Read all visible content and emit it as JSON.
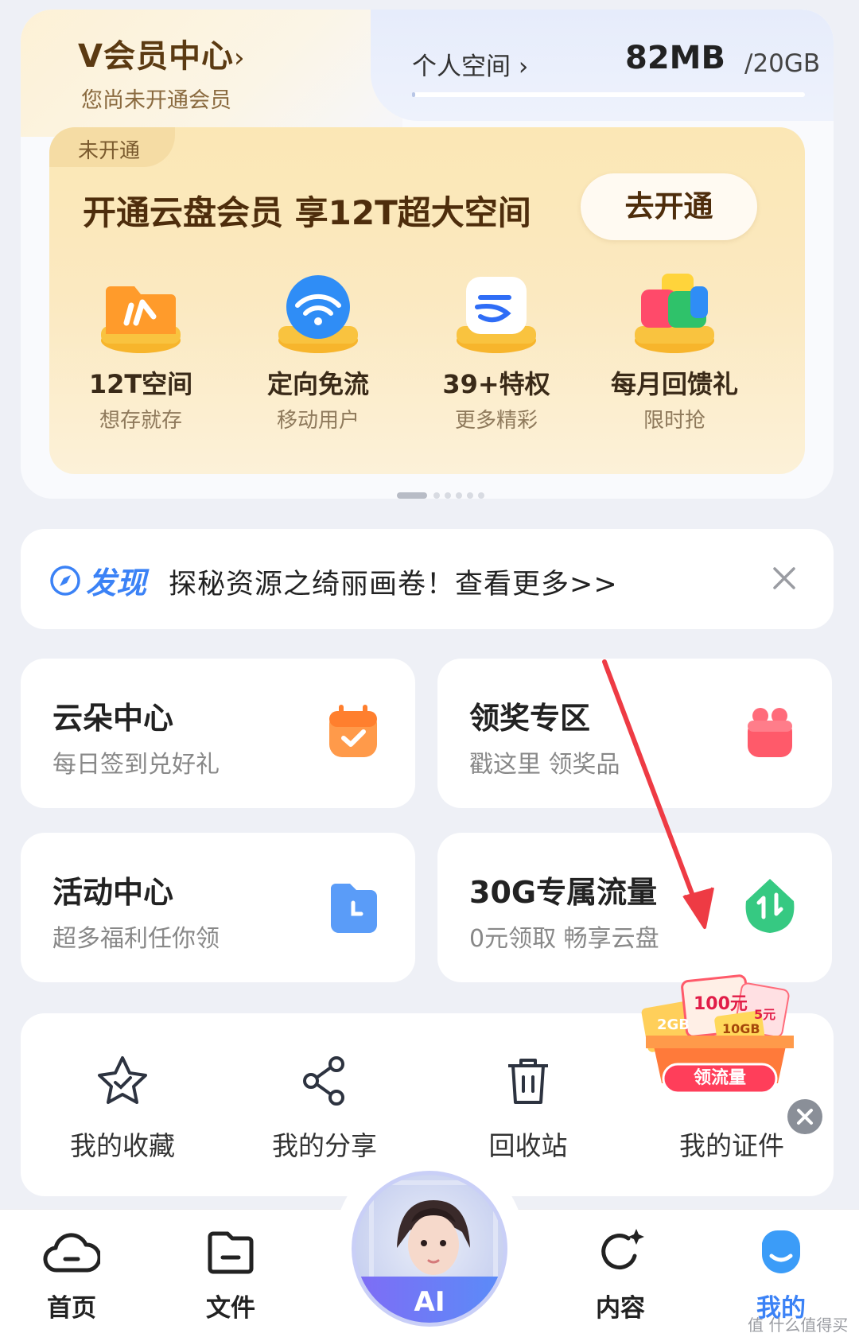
{
  "vip": {
    "title": "V会员中心",
    "chevron": "›",
    "subtitle": "您尚未开通会员",
    "personal_space_label": "个人空间 ›",
    "storage_used": "82MB",
    "storage_total": "/20GB",
    "storage_fraction": 0.004
  },
  "promo": {
    "tag": "未开通",
    "headline": "开通云盘会员 享12T超大空间",
    "button": "去开通",
    "features": [
      {
        "title": "12T空间",
        "subtitle": "想存就存",
        "icon": "folder-cloud-icon"
      },
      {
        "title": "定向免流",
        "subtitle": "移动用户",
        "icon": "wifi-icon"
      },
      {
        "title": "39+特权",
        "subtitle": "更多精彩",
        "icon": "cloud-logo-icon"
      },
      {
        "title": "每月回馈礼",
        "subtitle": "限时抢",
        "icon": "gift-apps-icon"
      }
    ],
    "page_dots": 6,
    "active_dot": 0
  },
  "discover": {
    "label": "发现",
    "text": "探秘资源之绮丽画卷！查看更多>>"
  },
  "cards": [
    {
      "title": "云朵中心",
      "subtitle": "每日签到兑好礼",
      "icon": "calendar-check-icon",
      "color": "#ff8a3d"
    },
    {
      "title": "领奖专区",
      "subtitle": "戳这里 领奖品",
      "icon": "gift-icon",
      "color": "#ff5a6a"
    },
    {
      "title": "活动中心",
      "subtitle": "超多福利任你领",
      "icon": "folder-clock-icon",
      "color": "#4f8ff7"
    },
    {
      "title": "30G专属流量",
      "subtitle": "0元领取 畅享云盘",
      "icon": "data-traffic-icon",
      "color": "#2fc07a"
    }
  ],
  "tools": [
    {
      "label": "我的收藏",
      "icon": "star-icon"
    },
    {
      "label": "我的分享",
      "icon": "share-icon"
    },
    {
      "label": "回收站",
      "icon": "trash-icon"
    },
    {
      "label": "我的证件",
      "icon": "id-card-icon"
    }
  ],
  "floating_promo": {
    "button": "领流量",
    "coupon1": "100元",
    "coupon2": "5元",
    "coupon3": "10GB",
    "coupon4": "2GB"
  },
  "nav": [
    {
      "label": "首页",
      "icon": "cloud-home-icon"
    },
    {
      "label": "文件",
      "icon": "folder-icon"
    },
    {
      "label": "AI",
      "icon": "ai-avatar"
    },
    {
      "label": "内容",
      "icon": "refresh-sparkle-icon"
    },
    {
      "label": "我的",
      "icon": "smile-face-icon"
    }
  ],
  "active_color": "#3b82f6",
  "watermark": "值 什么值得买"
}
